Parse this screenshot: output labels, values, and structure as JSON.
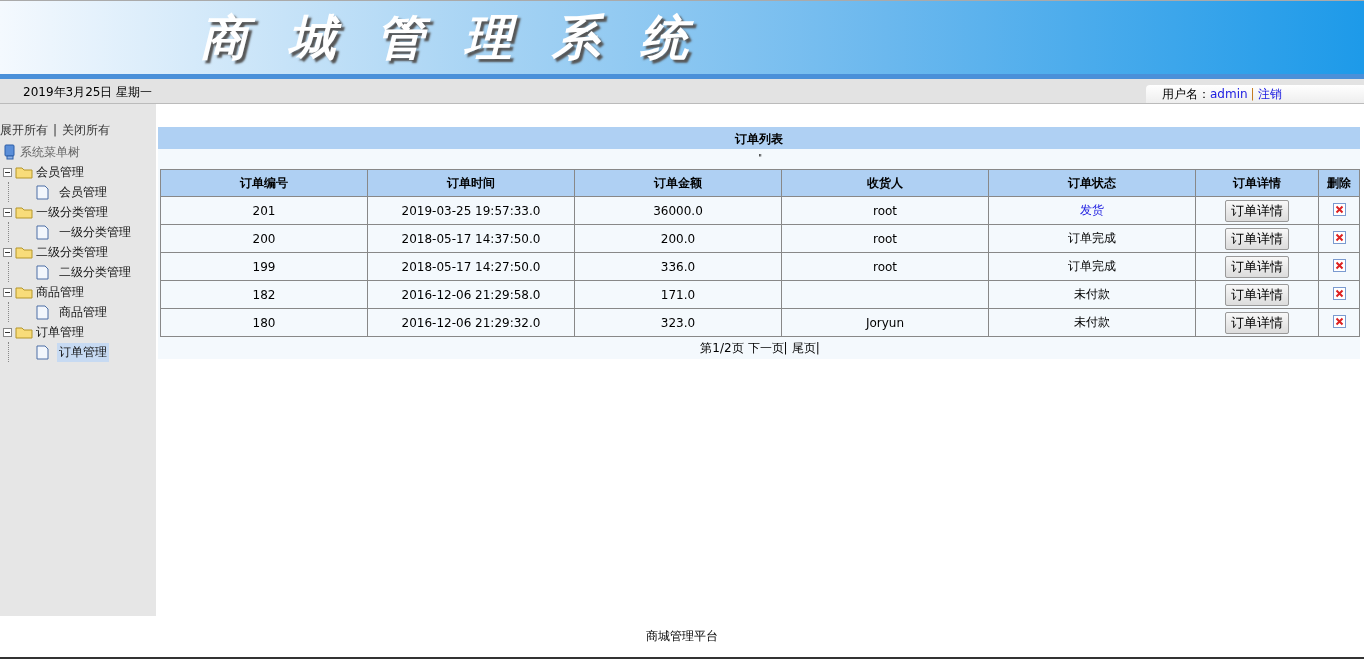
{
  "header": {
    "title": "商城管理系统"
  },
  "info_bar": {
    "date": "2019年3月25日 星期一",
    "user_label": "用户名：",
    "username": "admin",
    "separator": "|",
    "logout": "注销"
  },
  "sidebar": {
    "expand_all": "展开所有",
    "separator": "|",
    "collapse_all": "关闭所有",
    "root": "系统菜单树",
    "items": [
      {
        "label": "会员管理",
        "expanded": true,
        "children": [
          {
            "label": "会员管理",
            "selected": false
          }
        ]
      },
      {
        "label": "一级分类管理",
        "expanded": true,
        "children": [
          {
            "label": "一级分类管理",
            "selected": false
          }
        ]
      },
      {
        "label": "二级分类管理",
        "expanded": true,
        "children": [
          {
            "label": "二级分类管理",
            "selected": false
          }
        ]
      },
      {
        "label": "商品管理",
        "expanded": true,
        "children": [
          {
            "label": "商品管理",
            "selected": false
          }
        ]
      },
      {
        "label": "订单管理",
        "expanded": true,
        "children": [
          {
            "label": "订单管理",
            "selected": true
          }
        ]
      }
    ]
  },
  "table": {
    "title": "订单列表",
    "note": "\"",
    "columns": [
      "订单编号",
      "订单时间",
      "订单金额",
      "收货人",
      "订单状态",
      "订单详情",
      "删除"
    ],
    "rows": [
      {
        "id": "201",
        "time": "2019-03-25 19:57:33.0",
        "amount": "36000.0",
        "receiver": "root",
        "status": "发货",
        "kind": "link",
        "detail": "订单详情"
      },
      {
        "id": "200",
        "time": "2018-05-17 14:37:50.0",
        "amount": "200.0",
        "receiver": "root",
        "status": "订单完成",
        "kind": "text",
        "detail": "订单详情"
      },
      {
        "id": "199",
        "time": "2018-05-17 14:27:50.0",
        "amount": "336.0",
        "receiver": "root",
        "status": "订单完成",
        "kind": "text",
        "detail": "订单详情"
      },
      {
        "id": "182",
        "time": "2016-12-06 21:29:58.0",
        "amount": "171.0",
        "receiver": "",
        "status": "未付款",
        "kind": "text",
        "detail": "订单详情"
      },
      {
        "id": "180",
        "time": "2016-12-06 21:29:32.0",
        "amount": "323.0",
        "receiver": "Joryun",
        "status": "未付款",
        "kind": "text",
        "detail": "订单详情"
      }
    ]
  },
  "pagination": {
    "info": "第1/2页",
    "links": [
      {
        "label": "下一页",
        "sep": "|"
      },
      {
        "label": "尾页",
        "sep": "|"
      }
    ]
  },
  "footer": "商城管理平台"
}
